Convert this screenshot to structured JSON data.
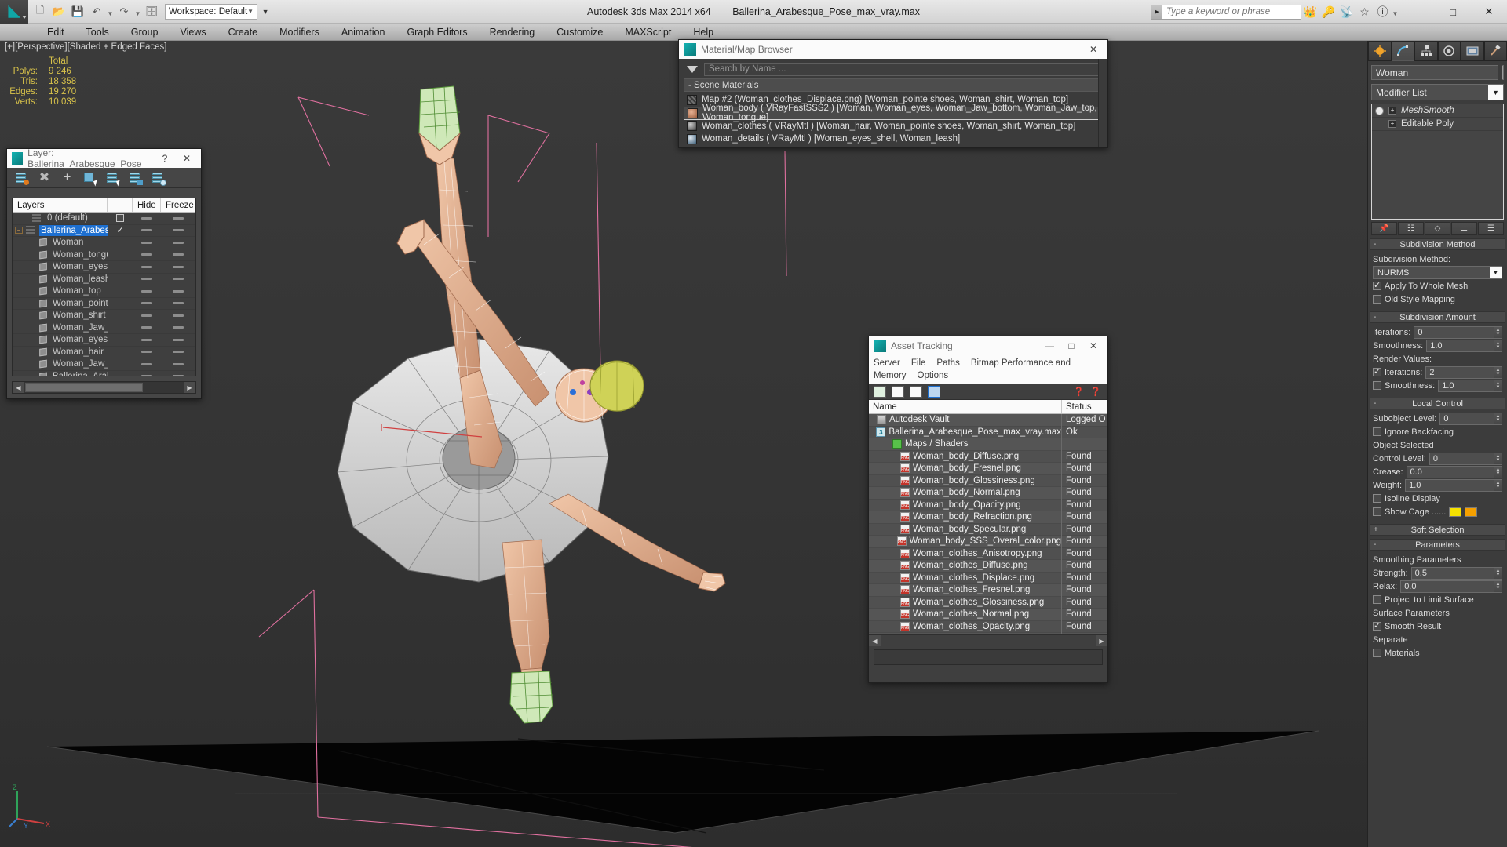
{
  "titlebar": {
    "workspace": "Workspace: Default",
    "app_title": "Autodesk 3ds Max  2014 x64",
    "file_title": "Ballerina_Arabesque_Pose_max_vray.max",
    "search_placeholder": "Type a keyword or phrase",
    "quick_access": [
      "new-icon",
      "open-icon",
      "save-icon",
      "undo-icon",
      "redo-icon",
      "project-folder-icon"
    ],
    "right_icons": [
      "binoculars-icon",
      "key-icon",
      "satellite-icon",
      "star-icon",
      "help-icon"
    ],
    "window_buttons": {
      "minimize": "—",
      "maximize": "□",
      "close": "✕"
    }
  },
  "menubar": {
    "items": [
      "Edit",
      "Tools",
      "Group",
      "Views",
      "Create",
      "Modifiers",
      "Animation",
      "Graph Editors",
      "Rendering",
      "Customize",
      "MAXScript",
      "Help"
    ]
  },
  "viewport": {
    "label": "[+][Perspective][Shaded + Edged Faces]",
    "stats_header": "Total",
    "stats": [
      {
        "key": "Polys:",
        "value": "9 246"
      },
      {
        "key": "Tris:",
        "value": "18 358"
      },
      {
        "key": "Edges:",
        "value": "19 270"
      },
      {
        "key": "Verts:",
        "value": "10 039"
      }
    ],
    "axis": {
      "x": "X",
      "y": "Y",
      "z": "Z"
    }
  },
  "layer_window": {
    "title": "Layer: Ballerina_Arabesque_Pose",
    "help_button": "?",
    "close_button": "✕",
    "columns": [
      "Layers",
      "",
      "Hide",
      "Freeze"
    ],
    "toolbar_icons": [
      "create-new-layer-icon",
      "delete-layer-icon",
      "add-layer-icon",
      "select-objects-in-layer-icon",
      "select-highlighted-objects-icon",
      "add-selection-to-layer-icon",
      "set-current-layer-icon"
    ],
    "rows": [
      {
        "name": "0 (default)",
        "type": "layer",
        "indent": 1,
        "expand": false,
        "current": "checkbox",
        "hide": true,
        "freeze": true
      },
      {
        "name": "Ballerina_Arabesque_Pose",
        "type": "layer",
        "indent": 0,
        "expand": true,
        "selected": true,
        "current": "check",
        "hide": true,
        "freeze": true
      },
      {
        "name": "Woman",
        "type": "object",
        "indent": 2,
        "hide": true,
        "freeze": true
      },
      {
        "name": "Woman_tongue",
        "type": "object",
        "indent": 2,
        "hide": true,
        "freeze": true
      },
      {
        "name": "Woman_eyes",
        "type": "object",
        "indent": 2,
        "hide": true,
        "freeze": true
      },
      {
        "name": "Woman_leash",
        "type": "object",
        "indent": 2,
        "hide": true,
        "freeze": true
      },
      {
        "name": "Woman_top",
        "type": "object",
        "indent": 2,
        "hide": true,
        "freeze": true
      },
      {
        "name": "Woman_pointe shoes",
        "type": "object",
        "indent": 2,
        "hide": true,
        "freeze": true
      },
      {
        "name": "Woman_shirt",
        "type": "object",
        "indent": 2,
        "hide": true,
        "freeze": true
      },
      {
        "name": "Woman_Jaw_bottom",
        "type": "object",
        "indent": 2,
        "hide": true,
        "freeze": true
      },
      {
        "name": "Woman_eyes_shell",
        "type": "object",
        "indent": 2,
        "hide": true,
        "freeze": true
      },
      {
        "name": "Woman_hair",
        "type": "object",
        "indent": 2,
        "hide": true,
        "freeze": true
      },
      {
        "name": "Woman_Jaw_top",
        "type": "object",
        "indent": 2,
        "hide": true,
        "freeze": true
      },
      {
        "name": "Ballerina_Arabesque_Pose",
        "type": "object",
        "indent": 2,
        "hide": true,
        "freeze": true
      }
    ]
  },
  "material_browser": {
    "title": "Material/Map Browser",
    "close_button": "✕",
    "search_placeholder": "Search by Name ...",
    "group_label": "-  Scene Materials",
    "items": [
      {
        "swatch": "map",
        "label": "Map #2 (Woman_clothes_Displace.png)  [Woman_pointe shoes, Woman_shirt, Woman_top]",
        "selected": false
      },
      {
        "swatch": "skin",
        "label": "Woman_body  ( VRayFastSSS2 )  [Woman, Woman_eyes, Woman_Jaw_bottom, Woman_Jaw_top, Woman_tongue]",
        "selected": true
      },
      {
        "swatch": "dark",
        "label": "Woman_clothes  ( VRayMtl )  [Woman_hair, Woman_pointe shoes, Woman_shirt, Woman_top]",
        "selected": false
      },
      {
        "swatch": "blue",
        "label": "Woman_details  ( VRayMtl )  [Woman_eyes_shell, Woman_leash]",
        "selected": false
      }
    ]
  },
  "asset_tracking": {
    "title": "Asset Tracking",
    "window_buttons": {
      "minimize": "—",
      "maximize": "□",
      "close": "✕"
    },
    "menus": [
      "Server",
      "File",
      "Paths",
      "Bitmap Performance and Memory",
      "Options"
    ],
    "toolbar_icons": [
      "refresh-icon",
      "list-view-icon",
      "detail-view-icon",
      "grid-view-icon",
      "help-add-icon",
      "help-icon"
    ],
    "columns": [
      "Name",
      "Status"
    ],
    "rows": [
      {
        "icon": "vault-icon",
        "name": "Autodesk Vault",
        "status": "Logged O",
        "indent": 1
      },
      {
        "icon": "max-file-icon",
        "name": "Ballerina_Arabesque_Pose_max_vray.max",
        "status": "Ok",
        "indent": 2
      },
      {
        "icon": "maps-shaders-icon",
        "name": "Maps / Shaders",
        "status": "",
        "indent": 3
      },
      {
        "icon": "png-icon",
        "name": "Woman_body_Diffuse.png",
        "status": "Found",
        "indent": 4
      },
      {
        "icon": "png-icon",
        "name": "Woman_body_Fresnel.png",
        "status": "Found",
        "indent": 4
      },
      {
        "icon": "png-icon",
        "name": "Woman_body_Glossiness.png",
        "status": "Found",
        "indent": 4
      },
      {
        "icon": "png-icon",
        "name": "Woman_body_Normal.png",
        "status": "Found",
        "indent": 4
      },
      {
        "icon": "png-icon",
        "name": "Woman_body_Opacity.png",
        "status": "Found",
        "indent": 4
      },
      {
        "icon": "png-icon",
        "name": "Woman_body_Refraction.png",
        "status": "Found",
        "indent": 4
      },
      {
        "icon": "png-icon",
        "name": "Woman_body_Specular.png",
        "status": "Found",
        "indent": 4
      },
      {
        "icon": "png-icon",
        "name": "Woman_body_SSS_Overal_color.png",
        "status": "Found",
        "indent": 4
      },
      {
        "icon": "png-icon",
        "name": "Woman_clothes_Anisotropy.png",
        "status": "Found",
        "indent": 4
      },
      {
        "icon": "png-icon",
        "name": "Woman_clothes_Diffuse.png",
        "status": "Found",
        "indent": 4
      },
      {
        "icon": "png-icon",
        "name": "Woman_clothes_Displace.png",
        "status": "Found",
        "indent": 4
      },
      {
        "icon": "png-icon",
        "name": "Woman_clothes_Fresnel.png",
        "status": "Found",
        "indent": 4
      },
      {
        "icon": "png-icon",
        "name": "Woman_clothes_Glossiness.png",
        "status": "Found",
        "indent": 4
      },
      {
        "icon": "png-icon",
        "name": "Woman_clothes_Normal.png",
        "status": "Found",
        "indent": 4
      },
      {
        "icon": "png-icon",
        "name": "Woman_clothes_Opacity.png",
        "status": "Found",
        "indent": 4
      },
      {
        "icon": "png-icon",
        "name": "Woman_clothes_Reflection.png",
        "status": "Found",
        "indent": 4
      }
    ]
  },
  "command_panel": {
    "tabs": [
      "create-tab",
      "modify-tab",
      "hierarchy-tab",
      "motion-tab",
      "display-tab",
      "utilities-tab"
    ],
    "active_tab_index": 1,
    "object_name": "Woman",
    "modifier_list_label": "Modifier List",
    "modifier_stack": [
      {
        "label": "MeshSmooth",
        "italic": true
      },
      {
        "label": "Editable Poly",
        "italic": false
      }
    ],
    "stack_buttons": [
      "pin-stack-icon",
      "show-end-result-icon",
      "make-unique-icon",
      "remove-modifier-icon",
      "configure-sets-icon"
    ],
    "rollouts": [
      {
        "title": "Subdivision Method",
        "minus": "-",
        "fields": [
          {
            "type": "label",
            "label": "Subdivision Method:"
          },
          {
            "type": "dropdown",
            "value": "NURMS"
          },
          {
            "type": "checkbox",
            "label": "Apply To Whole Mesh",
            "checked": true
          },
          {
            "type": "checkbox",
            "label": "Old Style Mapping",
            "checked": false
          }
        ]
      },
      {
        "title": "Subdivision Amount",
        "minus": "-",
        "fields": [
          {
            "type": "spin",
            "label": "Iterations:",
            "value": "0"
          },
          {
            "type": "spin",
            "label": "Smoothness:",
            "value": "1.0"
          },
          {
            "type": "label",
            "label": "Render Values:"
          },
          {
            "type": "spin_check",
            "label": "Iterations:",
            "value": "2",
            "checked": true
          },
          {
            "type": "spin_check",
            "label": "Smoothness:",
            "value": "1.0",
            "checked": false
          }
        ]
      },
      {
        "title": "Local Control",
        "minus": "-",
        "fields": [
          {
            "type": "spin",
            "label": "Subobject Level:",
            "value": "0"
          },
          {
            "type": "checkbox",
            "label": "Ignore Backfacing",
            "checked": false
          },
          {
            "type": "label",
            "label": "Object Selected"
          },
          {
            "type": "spin",
            "label": "Control Level:",
            "value": "0"
          },
          {
            "type": "spin",
            "label": "Crease:",
            "value": "0.0"
          },
          {
            "type": "spin",
            "label": "Weight:",
            "value": "1.0"
          },
          {
            "type": "checkbox",
            "label": "Isoline Display",
            "checked": false
          },
          {
            "type": "checkbox_swatch",
            "label": "Show Cage ......",
            "checked": false,
            "colors": [
              "#f5e100",
              "#f5a000"
            ]
          }
        ]
      },
      {
        "title": "Soft Selection",
        "plus": "+",
        "fields": []
      },
      {
        "title": "Parameters",
        "minus": "-",
        "fields": [
          {
            "type": "label",
            "label": "Smoothing Parameters"
          },
          {
            "type": "spin",
            "label": "Strength:",
            "value": "0.5"
          },
          {
            "type": "spin",
            "label": "Relax:",
            "value": "0.0"
          },
          {
            "type": "checkbox",
            "label": "Project to Limit Surface",
            "checked": false
          },
          {
            "type": "label",
            "label": "Surface Parameters"
          },
          {
            "type": "checkbox",
            "label": "Smooth Result",
            "checked": true
          },
          {
            "type": "label",
            "label": "Separate"
          },
          {
            "type": "checkbox",
            "label": "Materials",
            "checked": false
          }
        ]
      }
    ]
  },
  "colors": {
    "accent_blue": "#1d6fd0",
    "stats_yellow": "#d8c24a",
    "teal_logo": "#10a6a6",
    "viewport_bg": "#333333",
    "panel_bg": "#3c3c3c"
  }
}
